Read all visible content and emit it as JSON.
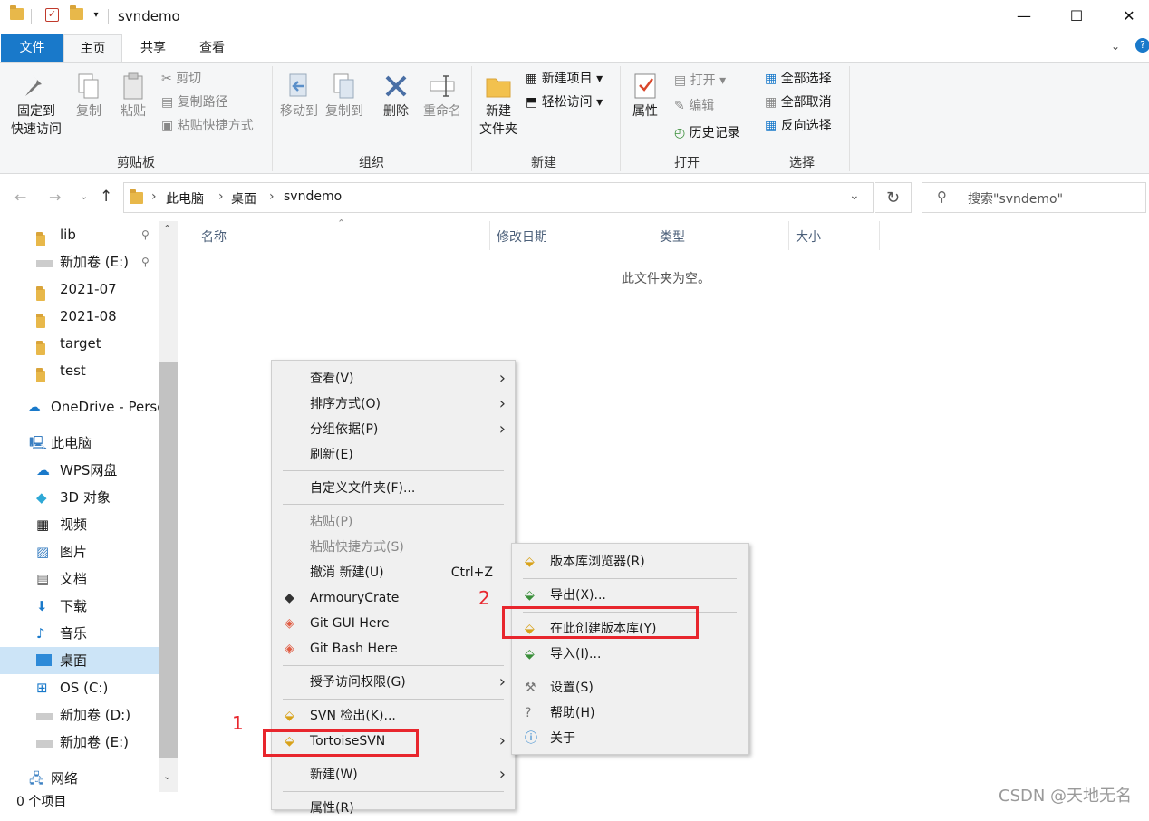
{
  "window": {
    "title": "svndemo",
    "minimize": "—",
    "maximize": "☐",
    "close": "✕"
  },
  "tabs": {
    "file": "文件",
    "home": "主页",
    "share": "共享",
    "view": "查看"
  },
  "ribbon": {
    "pin": "固定到\n快速访问",
    "copy": "复制",
    "paste": "粘贴",
    "cut": "剪切",
    "copy_path": "复制路径",
    "paste_shortcut": "粘贴快捷方式",
    "clipboard_group": "剪贴板",
    "move_to": "移动到",
    "copy_to": "复制到",
    "delete": "删除",
    "rename": "重命名",
    "organize_group": "组织",
    "new_folder_1": "新建",
    "new_folder_2": "文件夹",
    "new_item": "新建项目",
    "easy_access": "轻松访问",
    "new_group": "新建",
    "properties": "属性",
    "open": "打开",
    "edit": "编辑",
    "history": "历史记录",
    "open_group": "打开",
    "select_all": "全部选择",
    "select_none": "全部取消",
    "invert_selection": "反向选择",
    "select_group": "选择",
    "pin_l1": "固定到",
    "pin_l2": "快速访问"
  },
  "address": {
    "crumbs": [
      "此电脑",
      "桌面",
      "svndemo"
    ],
    "search_placeholder": "搜索\"svndemo\""
  },
  "sidebar": {
    "items": [
      "lib",
      "新加卷 (E:)",
      "2021-07",
      "2021-08",
      "target",
      "test",
      "OneDrive - Perso",
      "此电脑",
      "WPS网盘",
      "3D 对象",
      "视频",
      "图片",
      "文档",
      "下载",
      "音乐",
      "桌面",
      "OS (C:)",
      "新加卷 (D:)",
      "新加卷 (E:)",
      "网络"
    ]
  },
  "columns": {
    "name": "名称",
    "modified": "修改日期",
    "type": "类型",
    "size": "大小"
  },
  "empty_message": "此文件夹为空。",
  "context_menu": {
    "view": "查看(V)",
    "sort": "排序方式(O)",
    "group": "分组依据(P)",
    "refresh": "刷新(E)",
    "customize": "自定义文件夹(F)...",
    "paste": "粘贴(P)",
    "paste_shortcut": "粘贴快捷方式(S)",
    "undo": "撤消 新建(U)",
    "undo_key": "Ctrl+Z",
    "armoury": "ArmouryCrate",
    "git_gui": "Git GUI Here",
    "git_bash": "Git Bash Here",
    "grant_access": "授予访问权限(G)",
    "svn_checkout": "SVN 检出(K)...",
    "tortoise": "TortoiseSVN",
    "new": "新建(W)",
    "properties": "属性(R)"
  },
  "submenu": {
    "repo_browser": "版本库浏览器(R)",
    "export": "导出(X)...",
    "create_repo": "在此创建版本库(Y)",
    "import": "导入(I)...",
    "settings": "设置(S)",
    "help": "帮助(H)",
    "about": "关于"
  },
  "annotations": {
    "one": "1",
    "two": "2"
  },
  "status": "0 个项目",
  "watermark": "CSDN @天地无名"
}
